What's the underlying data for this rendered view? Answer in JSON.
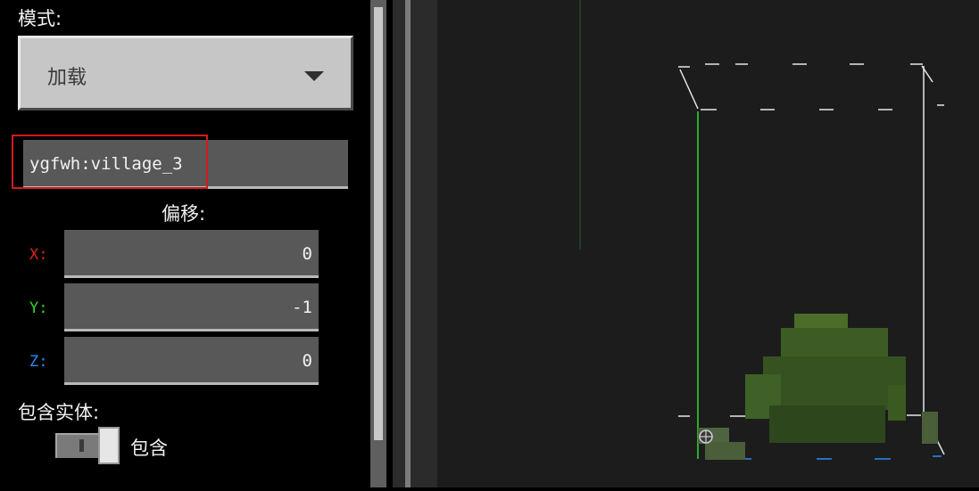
{
  "panel": {
    "mode_label": "模式:",
    "mode_value": "加载",
    "structure_name": "ygfwh:village_3",
    "offset_label": "偏移:",
    "offset": [
      {
        "axis": "X:",
        "value": "0",
        "color": "#e02020"
      },
      {
        "axis": "Y:",
        "value": "-1",
        "color": "#2fd62f"
      },
      {
        "axis": "Z:",
        "value": "0",
        "color": "#2a8cf0"
      }
    ],
    "include_entities_label": "包含实体:",
    "include_entities_value": "包含",
    "include_entities_on": false
  },
  "icons": {
    "dropdown": "chevron-down-icon",
    "origin": "crosshair-icon"
  }
}
